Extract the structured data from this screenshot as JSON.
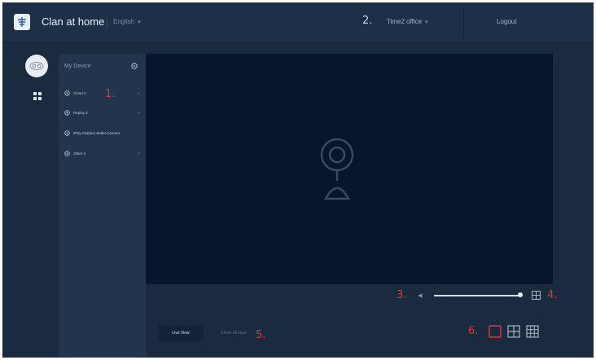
{
  "header": {
    "app_title": "Clan at home",
    "language": "English",
    "site": "Time2 office",
    "logout_label": "Logout"
  },
  "device_panel": {
    "title": "My Device",
    "devices": [
      {
        "label": "Cloud 2",
        "has_children": true
      },
      {
        "label": "Replay 2",
        "has_children": true
      },
      {
        "label": "iPlay Outdoor Bullet Camera",
        "has_children": false
      },
      {
        "label": "Other 2",
        "has_children": true
      }
    ]
  },
  "playback": {
    "tabs": [
      {
        "label": "Live View",
        "active": true
      },
      {
        "label": "Cloud Storage",
        "active": false
      }
    ],
    "volume_fraction": 0.96,
    "layouts": [
      "single-view",
      "quad-view",
      "nine-view"
    ],
    "active_layout": "single-view"
  },
  "annotations": [
    "1.",
    "2.",
    "3.",
    "4.",
    "5.",
    "6."
  ],
  "colors": {
    "background": "#1a2b40",
    "panel": "#22354d",
    "video": "#08152a",
    "annotation": "#e8343a"
  },
  "icons": [
    "app-logo-icon",
    "avatar-icon",
    "grid-icon",
    "gear-icon",
    "device-icon",
    "camera-placeholder-icon",
    "mute-icon",
    "fullscreen-icon",
    "single-view-icon",
    "quad-view-icon",
    "nine-view-icon"
  ]
}
